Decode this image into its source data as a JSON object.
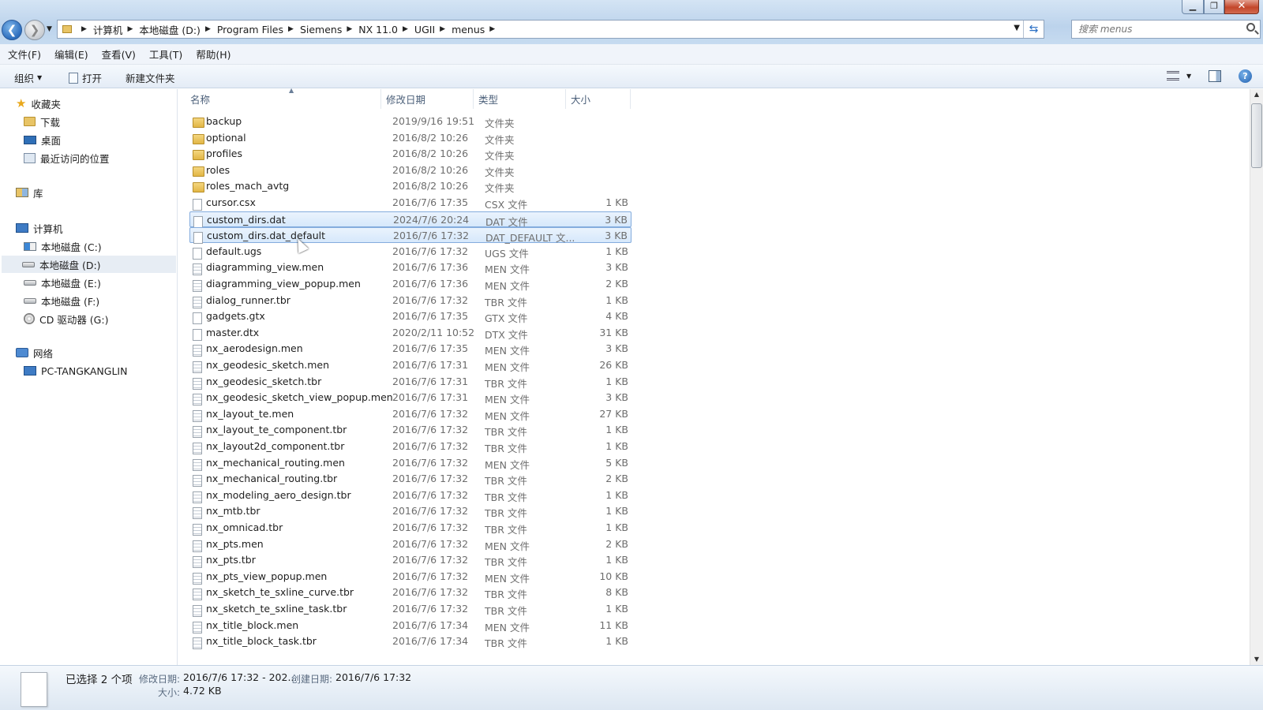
{
  "window": {
    "minimize_glyph": "▁",
    "maximize_glyph": "❐",
    "close_glyph": "✕"
  },
  "address": {
    "breadcrumbs": [
      "计算机",
      "本地磁盘 (D:)",
      "Program Files",
      "Siemens",
      "NX 11.0",
      "UGII",
      "menus"
    ]
  },
  "search": {
    "placeholder": "搜索 menus"
  },
  "menubar": [
    "文件(F)",
    "编辑(E)",
    "查看(V)",
    "工具(T)",
    "帮助(H)"
  ],
  "toolbar": {
    "organize": "组织",
    "open": "打开",
    "new_folder": "新建文件夹"
  },
  "navigation": {
    "favorites": "收藏夹",
    "favorites_items": [
      "下载",
      "桌面",
      "最近访问的位置"
    ],
    "libraries": "库",
    "computer": "计算机",
    "drives": [
      "本地磁盘 (C:)",
      "本地磁盘 (D:)",
      "本地磁盘 (E:)",
      "本地磁盘 (F:)",
      "CD 驱动器 (G:)"
    ],
    "selected_drive": "本地磁盘 (D:)",
    "network": "网络",
    "network_items": [
      "PC-TANGKANGLIN"
    ]
  },
  "columns": {
    "name": "名称",
    "date": "修改日期",
    "type": "类型",
    "size": "大小"
  },
  "files": [
    {
      "name": "backup",
      "date": "2019/9/16 19:51",
      "type": "文件夹",
      "size": "",
      "kind": "folder"
    },
    {
      "name": "optional",
      "date": "2016/8/2 10:26",
      "type": "文件夹",
      "size": "",
      "kind": "folder"
    },
    {
      "name": "profiles",
      "date": "2016/8/2 10:26",
      "type": "文件夹",
      "size": "",
      "kind": "folder"
    },
    {
      "name": "roles",
      "date": "2016/8/2 10:26",
      "type": "文件夹",
      "size": "",
      "kind": "folder"
    },
    {
      "name": "roles_mach_avtg",
      "date": "2016/8/2 10:26",
      "type": "文件夹",
      "size": "",
      "kind": "folder"
    },
    {
      "name": "cursor.csx",
      "date": "2016/7/6 17:35",
      "type": "CSX 文件",
      "size": "1 KB",
      "kind": "file"
    },
    {
      "name": "custom_dirs.dat",
      "date": "2024/7/6 20:24",
      "type": "DAT 文件",
      "size": "3 KB",
      "kind": "file",
      "selected": true
    },
    {
      "name": "custom_dirs.dat_default",
      "date": "2016/7/6 17:32",
      "type": "DAT_DEFAULT 文...",
      "size": "3 KB",
      "kind": "file",
      "selected": true
    },
    {
      "name": "default.ugs",
      "date": "2016/7/6 17:32",
      "type": "UGS 文件",
      "size": "1 KB",
      "kind": "file"
    },
    {
      "name": "diagramming_view.men",
      "date": "2016/7/6 17:36",
      "type": "MEN 文件",
      "size": "3 KB",
      "kind": "menu"
    },
    {
      "name": "diagramming_view_popup.men",
      "date": "2016/7/6 17:36",
      "type": "MEN 文件",
      "size": "2 KB",
      "kind": "menu"
    },
    {
      "name": "dialog_runner.tbr",
      "date": "2016/7/6 17:32",
      "type": "TBR 文件",
      "size": "1 KB",
      "kind": "menu"
    },
    {
      "name": "gadgets.gtx",
      "date": "2016/7/6 17:35",
      "type": "GTX 文件",
      "size": "4 KB",
      "kind": "file"
    },
    {
      "name": "master.dtx",
      "date": "2020/2/11 10:52",
      "type": "DTX 文件",
      "size": "31 KB",
      "kind": "file"
    },
    {
      "name": "nx_aerodesign.men",
      "date": "2016/7/6 17:35",
      "type": "MEN 文件",
      "size": "3 KB",
      "kind": "menu"
    },
    {
      "name": "nx_geodesic_sketch.men",
      "date": "2016/7/6 17:31",
      "type": "MEN 文件",
      "size": "26 KB",
      "kind": "menu"
    },
    {
      "name": "nx_geodesic_sketch.tbr",
      "date": "2016/7/6 17:31",
      "type": "TBR 文件",
      "size": "1 KB",
      "kind": "menu"
    },
    {
      "name": "nx_geodesic_sketch_view_popup.men",
      "date": "2016/7/6 17:31",
      "type": "MEN 文件",
      "size": "3 KB",
      "kind": "menu"
    },
    {
      "name": "nx_layout_te.men",
      "date": "2016/7/6 17:32",
      "type": "MEN 文件",
      "size": "27 KB",
      "kind": "menu"
    },
    {
      "name": "nx_layout_te_component.tbr",
      "date": "2016/7/6 17:32",
      "type": "TBR 文件",
      "size": "1 KB",
      "kind": "menu"
    },
    {
      "name": "nx_layout2d_component.tbr",
      "date": "2016/7/6 17:32",
      "type": "TBR 文件",
      "size": "1 KB",
      "kind": "menu"
    },
    {
      "name": "nx_mechanical_routing.men",
      "date": "2016/7/6 17:32",
      "type": "MEN 文件",
      "size": "5 KB",
      "kind": "menu"
    },
    {
      "name": "nx_mechanical_routing.tbr",
      "date": "2016/7/6 17:32",
      "type": "TBR 文件",
      "size": "2 KB",
      "kind": "menu"
    },
    {
      "name": "nx_modeling_aero_design.tbr",
      "date": "2016/7/6 17:32",
      "type": "TBR 文件",
      "size": "1 KB",
      "kind": "menu"
    },
    {
      "name": "nx_mtb.tbr",
      "date": "2016/7/6 17:32",
      "type": "TBR 文件",
      "size": "1 KB",
      "kind": "menu"
    },
    {
      "name": "nx_omnicad.tbr",
      "date": "2016/7/6 17:32",
      "type": "TBR 文件",
      "size": "1 KB",
      "kind": "menu"
    },
    {
      "name": "nx_pts.men",
      "date": "2016/7/6 17:32",
      "type": "MEN 文件",
      "size": "2 KB",
      "kind": "menu"
    },
    {
      "name": "nx_pts.tbr",
      "date": "2016/7/6 17:32",
      "type": "TBR 文件",
      "size": "1 KB",
      "kind": "menu"
    },
    {
      "name": "nx_pts_view_popup.men",
      "date": "2016/7/6 17:32",
      "type": "MEN 文件",
      "size": "10 KB",
      "kind": "menu"
    },
    {
      "name": "nx_sketch_te_sxline_curve.tbr",
      "date": "2016/7/6 17:32",
      "type": "TBR 文件",
      "size": "8 KB",
      "kind": "menu"
    },
    {
      "name": "nx_sketch_te_sxline_task.tbr",
      "date": "2016/7/6 17:32",
      "type": "TBR 文件",
      "size": "1 KB",
      "kind": "menu"
    },
    {
      "name": "nx_title_block.men",
      "date": "2016/7/6 17:34",
      "type": "MEN 文件",
      "size": "11 KB",
      "kind": "menu"
    },
    {
      "name": "nx_title_block_task.tbr",
      "date": "2016/7/6 17:34",
      "type": "TBR 文件",
      "size": "1 KB",
      "kind": "menu"
    }
  ],
  "details": {
    "selected_count": "已选择 2 个项",
    "modified_label": "修改日期:",
    "modified_value": "2016/7/6 17:32 - 202...",
    "created_label": "创建日期:",
    "created_value": "2016/7/6 17:32",
    "size_label": "大小:",
    "size_value": "4.72 KB"
  }
}
